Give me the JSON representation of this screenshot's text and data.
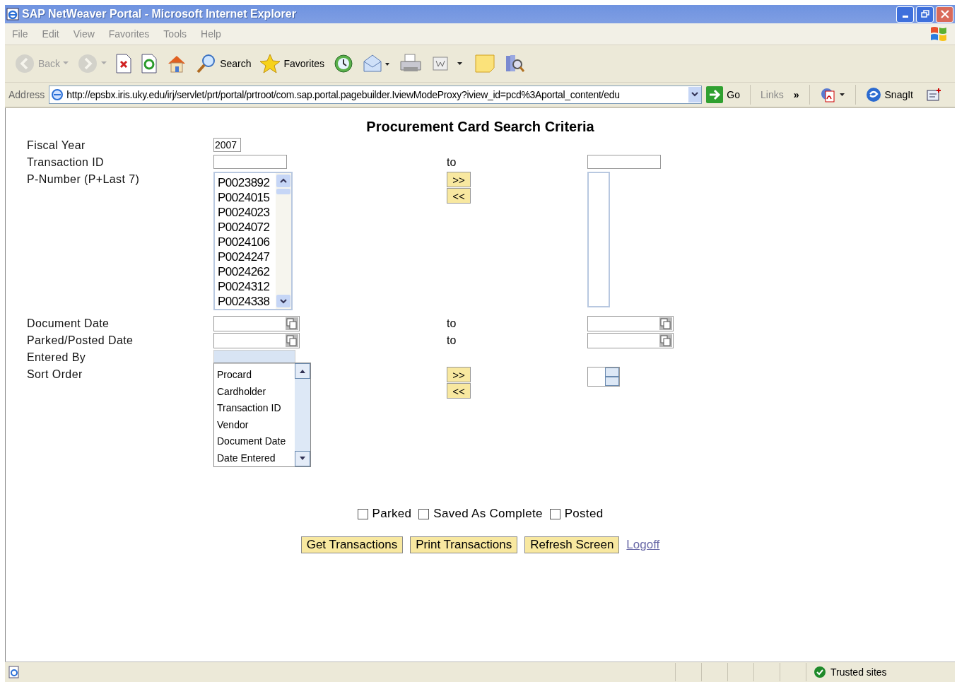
{
  "window": {
    "title": "SAP NetWeaver Portal - Microsoft Internet Explorer"
  },
  "menu": [
    "File",
    "Edit",
    "View",
    "Favorites",
    "Tools",
    "Help"
  ],
  "toolbar": [
    {
      "kind": "back",
      "label": "Back",
      "disabled": true
    },
    {
      "kind": "forward",
      "disabled": true
    },
    {
      "kind": "stop",
      "disabled": false
    },
    {
      "kind": "refresh",
      "disabled": false
    },
    {
      "kind": "home",
      "disabled": false
    },
    {
      "kind": "search",
      "label": "Search",
      "disabled": false
    },
    {
      "kind": "favorites",
      "label": "Favorites",
      "disabled": false
    },
    {
      "kind": "history",
      "disabled": false
    },
    {
      "kind": "mail",
      "disabled": false
    },
    {
      "kind": "print",
      "disabled": false
    },
    {
      "kind": "edit",
      "disabled": false
    },
    {
      "kind": "note",
      "disabled": false
    },
    {
      "kind": "research",
      "disabled": false
    }
  ],
  "address": {
    "label": "Address",
    "value": "http://epsbx.iris.uky.edu/irj/servlet/prt/portal/prtroot/com.sap.portal.pagebuilder.IviewModeProxy?iview_id=pcd%3Aportal_content/edu",
    "go": "Go",
    "links": "Links",
    "more": "»",
    "snagit": "SnagIt"
  },
  "form": {
    "title": "Procurement Card Search Criteria",
    "rows": [
      {
        "kind": "text",
        "label": "Fiscal Year",
        "value": "2007"
      },
      {
        "kind": "range",
        "label": "Transaction ID",
        "to": "to"
      },
      {
        "kind": "pick",
        "label": "P-Number (P+Last 7)",
        "options": [
          "P0023892",
          "P0024015",
          "P0024023",
          "P0024072",
          "P0024106",
          "P0024247",
          "P0024262",
          "P0024312",
          "P0024338"
        ],
        "add": ">>",
        "remove": "<<"
      },
      {
        "kind": "daterange",
        "label": "Document Date",
        "to": "to"
      },
      {
        "kind": "daterange",
        "label": "Parked/Posted Date",
        "to": "to"
      },
      {
        "kind": "readonly",
        "label": "Entered By"
      },
      {
        "kind": "sort",
        "label": "Sort Order",
        "options": [
          "Procard",
          "Cardholder",
          "Transaction ID",
          "Vendor",
          "Document Date",
          "Date Entered"
        ],
        "add": ">>",
        "remove": "<<"
      }
    ],
    "checkboxes": [
      {
        "label": "Parked",
        "checked": false
      },
      {
        "label": "Saved As Complete",
        "checked": false
      },
      {
        "label": "Posted",
        "checked": false
      }
    ],
    "buttons": [
      "Get Transactions",
      "Print Transactions",
      "Refresh Screen"
    ],
    "link": "Logoff"
  },
  "status_bar": {
    "zone": "Trusted sites"
  }
}
